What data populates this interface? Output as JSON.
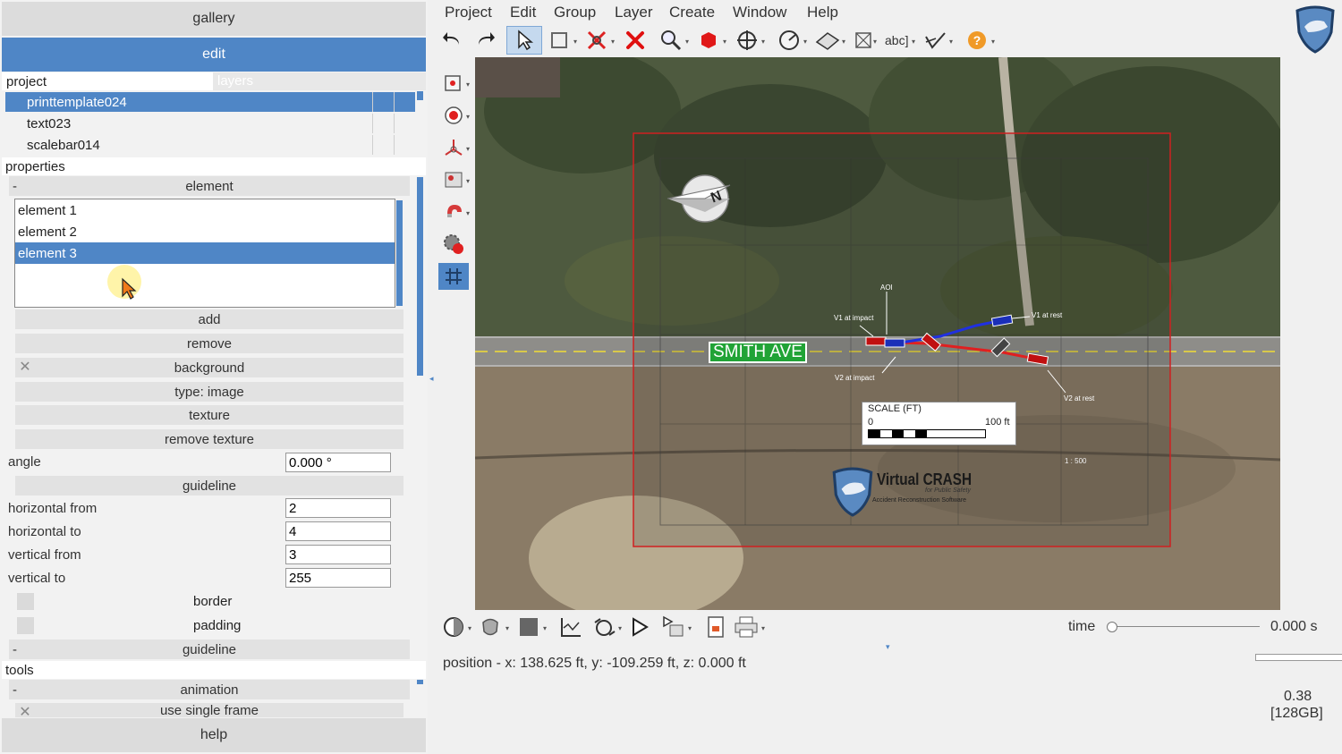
{
  "left": {
    "gallery_label": "gallery",
    "edit_label": "edit",
    "project_tab": "project",
    "layers_tab": "layers",
    "tree": [
      "printtemplate024",
      "text023",
      "scalebar014"
    ],
    "properties_label": "properties",
    "element_group": {
      "dash": "-",
      "label": "element"
    },
    "elements": [
      "element 1",
      "element 2",
      "element 3"
    ],
    "add_label": "add",
    "remove_label": "remove",
    "background_label": "background",
    "type_label": "type: image",
    "texture_label": "texture",
    "remove_texture_label": "remove texture",
    "angle_label": "angle",
    "angle_value": "0.000 °",
    "guideline_label": "guideline",
    "fields": [
      {
        "label": "horizontal from",
        "value": "2"
      },
      {
        "label": "horizontal to",
        "value": "4"
      },
      {
        "label": "vertical from",
        "value": "3"
      },
      {
        "label": "vertical to",
        "value": "255"
      }
    ],
    "border_label": "border",
    "padding_label": "padding",
    "guideline_group": {
      "dash": "-",
      "label": "guideline"
    },
    "tools_label": "tools",
    "animation_group": {
      "dash": "-",
      "label": "animation"
    },
    "single_frame_label": "use single frame",
    "help_label": "help"
  },
  "menu": [
    "Project",
    "Edit",
    "Group",
    "Layer",
    "Create",
    "Window",
    "Help"
  ],
  "toolbar_icons": [
    "undo-icon",
    "redo-icon",
    "select-arrow-icon",
    "rectangle-select-icon",
    "unlink-icon",
    "delete-x-icon",
    "zoom-icon",
    "cube-icon",
    "move-icon",
    "measure-icon",
    "surface-icon",
    "grid-icon",
    "text-icon",
    "path-icon",
    "help-icon"
  ],
  "toolbar_text_label": "abc]",
  "map": {
    "street": "SMITH AVE",
    "north": "N",
    "scale_title": "SCALE (FT)",
    "scale_zero": "0",
    "scale_max": "100 ft",
    "ratio": "1 : 500",
    "brand": "Virtual CRASH",
    "brand_sub1": "for Public Safety",
    "brand_sub2": "Accident Reconstruction Software",
    "annotations": [
      "AOI",
      "V1 at impact",
      "V1 at rest",
      "V2 at impact",
      "V2 at rest"
    ]
  },
  "bottom": {
    "time_label": "time",
    "time_value": "0.000 s",
    "position": "position - x: 138.625 ft, y: -109.259 ft, z: 0.000 ft",
    "version": "0.38",
    "memory": "[128GB]"
  },
  "colors": {
    "accent": "#4f86c6",
    "print_frame": "#d02020",
    "street_label": "#21a336"
  }
}
